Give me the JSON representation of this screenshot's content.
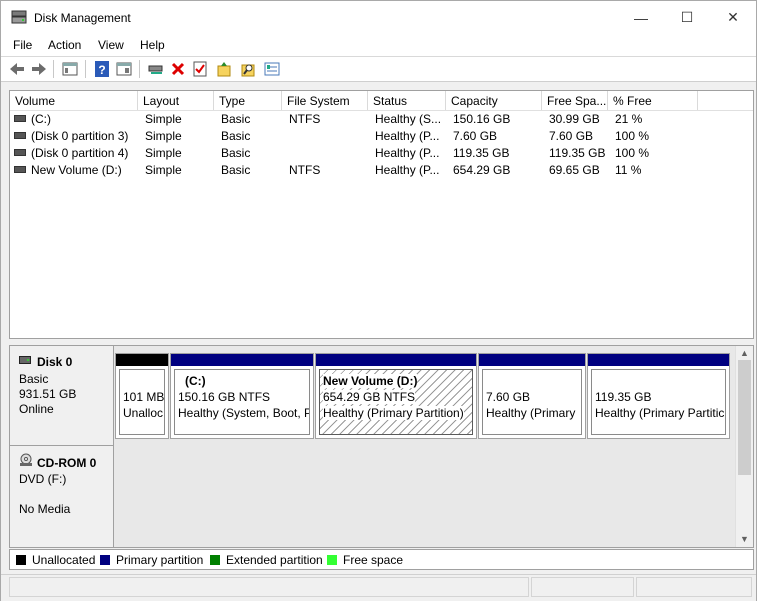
{
  "window": {
    "title": "Disk Management",
    "controls": {
      "minimize": "—",
      "maximize": "☐",
      "close": "✕"
    }
  },
  "menu": [
    "File",
    "Action",
    "View",
    "Help"
  ],
  "toolbar": [
    "back",
    "forward",
    "console-tree",
    "help",
    "properties",
    "connect-disk",
    "delete",
    "check",
    "open",
    "explore",
    "settings"
  ],
  "volumes": {
    "columns": [
      "Volume",
      "Layout",
      "Type",
      "File System",
      "Status",
      "Capacity",
      "Free Spa...",
      "% Free"
    ],
    "rows": [
      {
        "volume": "(C:)",
        "layout": "Simple",
        "type": "Basic",
        "fs": "NTFS",
        "status": "Healthy (S...",
        "capacity": "150.16 GB",
        "free": "30.99 GB",
        "pct": "21 %"
      },
      {
        "volume": "(Disk 0 partition 3)",
        "layout": "Simple",
        "type": "Basic",
        "fs": "",
        "status": "Healthy (P...",
        "capacity": "7.60 GB",
        "free": "7.60 GB",
        "pct": "100 %"
      },
      {
        "volume": "(Disk 0 partition 4)",
        "layout": "Simple",
        "type": "Basic",
        "fs": "",
        "status": "Healthy (P...",
        "capacity": "119.35 GB",
        "free": "119.35 GB",
        "pct": "100 %"
      },
      {
        "volume": "New Volume (D:)",
        "layout": "Simple",
        "type": "Basic",
        "fs": "NTFS",
        "status": "Healthy (P...",
        "capacity": "654.29 GB",
        "free": "69.65 GB",
        "pct": "11 %"
      }
    ]
  },
  "disks": [
    {
      "name": "Disk 0",
      "kind": "Basic",
      "size": "931.51 GB",
      "state": "Online",
      "partitions": [
        {
          "title": "",
          "line1": "101 MB",
          "line2": "Unalloc",
          "cap_color": "#000000",
          "selected": false
        },
        {
          "title": "(C:)",
          "line1": "150.16 GB NTFS",
          "line2": "Healthy (System, Boot, P",
          "cap_color": "#000080",
          "selected": false
        },
        {
          "title": "New Volume  (D:)",
          "line1": "654.29 GB NTFS",
          "line2": "Healthy (Primary Partition)",
          "cap_color": "#000080",
          "selected": true
        },
        {
          "title": "",
          "line1": "7.60 GB",
          "line2": "Healthy (Primary",
          "cap_color": "#000080",
          "selected": false
        },
        {
          "title": "",
          "line1": "119.35 GB",
          "line2": "Healthy (Primary Partitic",
          "cap_color": "#000080",
          "selected": false
        }
      ]
    },
    {
      "name": "CD-ROM 0",
      "kind": "DVD (F:)",
      "size": "",
      "state": "No Media"
    }
  ],
  "legend": [
    {
      "label": "Unallocated",
      "color": "#000000"
    },
    {
      "label": "Primary partition",
      "color": "#000080"
    },
    {
      "label": "Extended partition",
      "color": "#008000"
    },
    {
      "label": "Free space",
      "color": "#33ff33"
    }
  ]
}
